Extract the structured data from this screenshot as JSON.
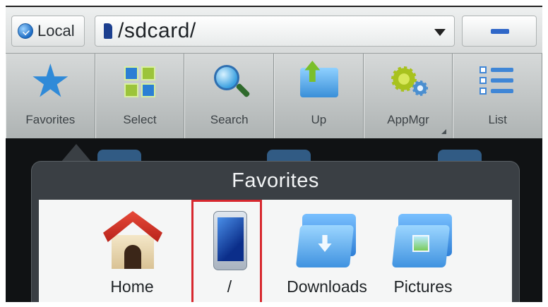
{
  "pathbar": {
    "location_label": "Local",
    "path": "/sdcard/",
    "icons": {
      "location": "globe-check-icon",
      "storage": "sdcard-icon",
      "dropdown": "chevron-down-icon",
      "minus": "minus-icon"
    },
    "accent_color": "#2f67c8"
  },
  "toolbar": {
    "items": [
      {
        "label": "Favorites",
        "icon": "star-icon"
      },
      {
        "label": "Select",
        "icon": "select-grid-icon"
      },
      {
        "label": "Search",
        "icon": "search-icon"
      },
      {
        "label": "Up",
        "icon": "folder-up-icon"
      },
      {
        "label": "AppMgr",
        "icon": "gear-icon"
      },
      {
        "label": "List",
        "icon": "list-icon"
      }
    ]
  },
  "favorites_popup": {
    "title": "Favorites",
    "items": [
      {
        "label": "Home",
        "icon": "home-icon",
        "selected": false
      },
      {
        "label": "/",
        "icon": "phone-icon",
        "selected": true
      },
      {
        "label": "Downloads",
        "icon": "folder-download-icon",
        "selected": false
      },
      {
        "label": "Pictures",
        "icon": "folder-pictures-icon",
        "selected": false
      }
    ],
    "selection_color": "#d7282f"
  }
}
